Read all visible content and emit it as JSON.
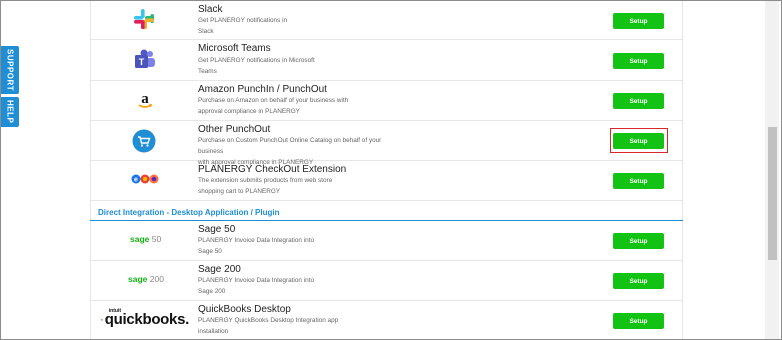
{
  "side_tabs": {
    "support": "SUPPORT",
    "help": "HELP"
  },
  "integrations": [
    {
      "name": "Slack",
      "desc_l1": "Get PLANERGY notifications in",
      "desc_l2": "Slack",
      "button": "Setup",
      "icon": "slack-logo"
    },
    {
      "name": "Microsoft Teams",
      "desc_l1": "Get PLANERGY notifications in Microsoft",
      "desc_l2": "Teams",
      "button": "Setup",
      "icon": "microsoft-teams-logo"
    },
    {
      "name": "Amazon PunchIn / PunchOut",
      "desc_l1": "Purchase on Amazon on behalf of your business with",
      "desc_l2": "approval compliance in PLANERGY",
      "button": "Setup",
      "icon": "amazon-logo"
    },
    {
      "name": "Other PunchOut",
      "desc_l1": "Purchase on Custom PunchOut Online Catalog on behalf of your business",
      "desc_l2": "with approval compliance in PLANERGY",
      "button": "Setup",
      "icon": "shopping-cart-icon"
    },
    {
      "name": "PLANERGY CheckOut Extension",
      "desc_l1": "The extension submits products from web store",
      "desc_l2": "shopping cart to PLANERGY",
      "button": "Setup",
      "icon": "browser-icons"
    }
  ],
  "section_title": "Direct Integration - Desktop Application / Plugin",
  "desktop": [
    {
      "name": "Sage 50",
      "desc_l1": "PLANERGY Invoice Data Integration into",
      "desc_l2": "Sage 50",
      "button": "Setup",
      "logo_brand": "sage",
      "logo_num": "50"
    },
    {
      "name": "Sage 200",
      "desc_l1": "PLANERGY Invoice Data Integration into",
      "desc_l2": "Sage 200",
      "button": "Setup",
      "logo_brand": "sage",
      "logo_num": "200"
    },
    {
      "name": "QuickBooks Desktop",
      "desc_l1": "PLANERGY QuickBooks Desktop Integration app",
      "desc_l2": "installation",
      "button": "Setup",
      "logo_top": "intuit",
      "logo_main": "quickbooks."
    }
  ],
  "colors": {
    "accent": "#1f8ed4",
    "button": "#13c313",
    "highlight": "#d9262b"
  }
}
